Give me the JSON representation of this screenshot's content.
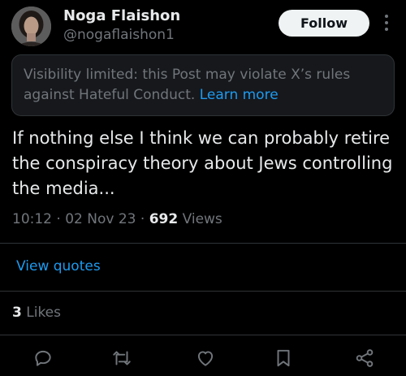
{
  "author": {
    "display_name": "Noga Flaishon",
    "handle": "@nogaflaishon1"
  },
  "follow_label": "Follow",
  "notice": {
    "text": "Visibility limited: this Post may violate X’s rules against Hateful Conduct.",
    "link": "Learn more"
  },
  "post": {
    "text": "If nothing else I think we can probably retire the conspiracy theory about Jews controlling the media..."
  },
  "meta": {
    "time": "10:12",
    "date": "02 Nov 23",
    "views_count": "692",
    "views_label": "Views",
    "separator": "·"
  },
  "view_quotes_label": "View quotes",
  "likes": {
    "count": "3",
    "label": "Likes"
  },
  "actions": [
    "reply-icon",
    "repost-icon",
    "like-icon",
    "bookmark-icon",
    "share-icon"
  ],
  "colors": {
    "background": "#000000",
    "text": "#e7e9ea",
    "muted": "#71767b",
    "link": "#1d9bf0",
    "border": "#2f3336"
  }
}
